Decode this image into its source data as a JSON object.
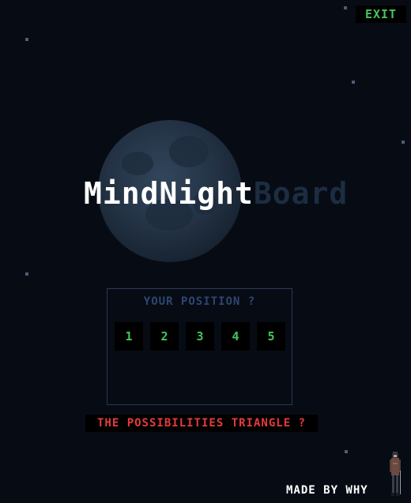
{
  "header": {
    "exit_label": "EXIT"
  },
  "title": {
    "part1": "MindNight",
    "part2": "Board"
  },
  "position_panel": {
    "heading": "YOUR POSITION ?",
    "options": [
      "1",
      "2",
      "3",
      "4",
      "5"
    ]
  },
  "triangle_button": {
    "label": "THE POSSIBILITIES TRIANGLE ?"
  },
  "footer": {
    "credit": "MADE BY WHY"
  },
  "icons": {
    "character": "character-sprite-icon",
    "moon": "moon-icon",
    "stars": "star-icon"
  },
  "colors": {
    "background": "#070b14",
    "accent_green": "#47c45a",
    "accent_red": "#e43b3b",
    "panel_heading": "#2e4670",
    "title_white": "#ffffff",
    "title_dim": "#1c2d42"
  }
}
